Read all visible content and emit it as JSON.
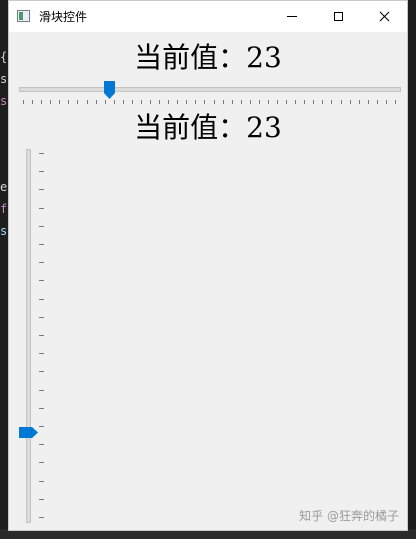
{
  "window": {
    "title": "滑块控件",
    "accent_color": "#0078d4"
  },
  "horizontal": {
    "label_prefix": "当前值：",
    "value": "23",
    "min": 0,
    "max": 100,
    "tick_count": 42
  },
  "vertical": {
    "label_prefix": "当前值：",
    "value": "23",
    "min": 0,
    "max": 100,
    "tick_count": 21
  },
  "labels": {
    "top": "当前值：23",
    "bottom": "当前值：23"
  },
  "background_fragments": [
    "{",
    "s",
    "se",
    "e",
    "f",
    "s"
  ],
  "watermark": "知乎 @狂奔的橘子",
  "icons": {
    "app": "app-window-icon",
    "minimize": "minimize-icon",
    "maximize": "maximize-icon",
    "close": "close-icon"
  }
}
